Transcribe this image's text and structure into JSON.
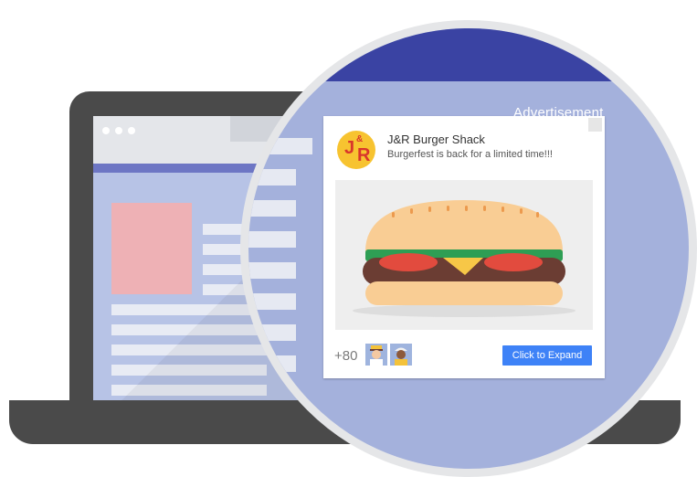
{
  "ad": {
    "label": "Advertisement",
    "brand_name": "J&R Burger Shack",
    "logo": {
      "j": "J",
      "amp": "&",
      "r": "R"
    },
    "tagline": "Burgerfest is back for a limited time!!!",
    "social_count": "+80",
    "cta_label": "Click to Expand",
    "image_icon": "burger-illustration"
  },
  "colors": {
    "laptop": "#4a4a4a",
    "screen_bg": "#b7c3e6",
    "magnifier_bg": "#a4b1dc",
    "magnifier_header": "#3a43a3",
    "logo_bg": "#f7c330",
    "logo_text": "#d9362b",
    "cta_bg": "#3e82f7"
  }
}
